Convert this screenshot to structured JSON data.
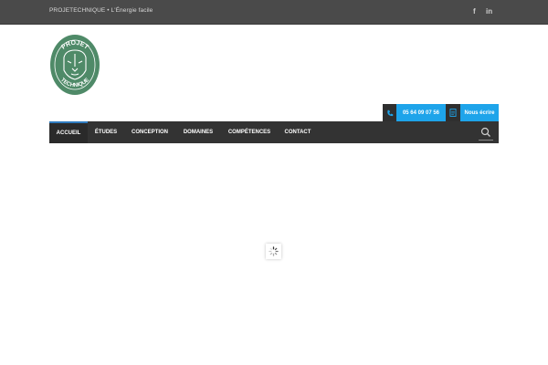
{
  "topbar": {
    "tagline": "PROJETECHNIQUE • L'Énergie facile",
    "social": [
      {
        "icon": "facebook-icon",
        "label": "f"
      },
      {
        "icon": "linkedin-icon",
        "label": "in"
      }
    ]
  },
  "logo": {
    "top_text": "PROJET",
    "bottom_text": "TECHNIQUE",
    "color": "#4f8a68"
  },
  "contact": {
    "phone": "05 64 09 07 56",
    "write_label": "Nous écrire",
    "accent": "#1ea4ea"
  },
  "nav": {
    "items": [
      {
        "label": "ACCUEIL",
        "active": true
      },
      {
        "label": "ÉTUDES",
        "active": false
      },
      {
        "label": "CONCEPTION",
        "active": false
      },
      {
        "label": "DOMAINES",
        "active": false
      },
      {
        "label": "COMPÉTENCES",
        "active": false
      },
      {
        "label": "CONTACT",
        "active": false
      }
    ],
    "search_icon": "search-icon"
  },
  "loader": {
    "icon": "spinner-icon"
  }
}
